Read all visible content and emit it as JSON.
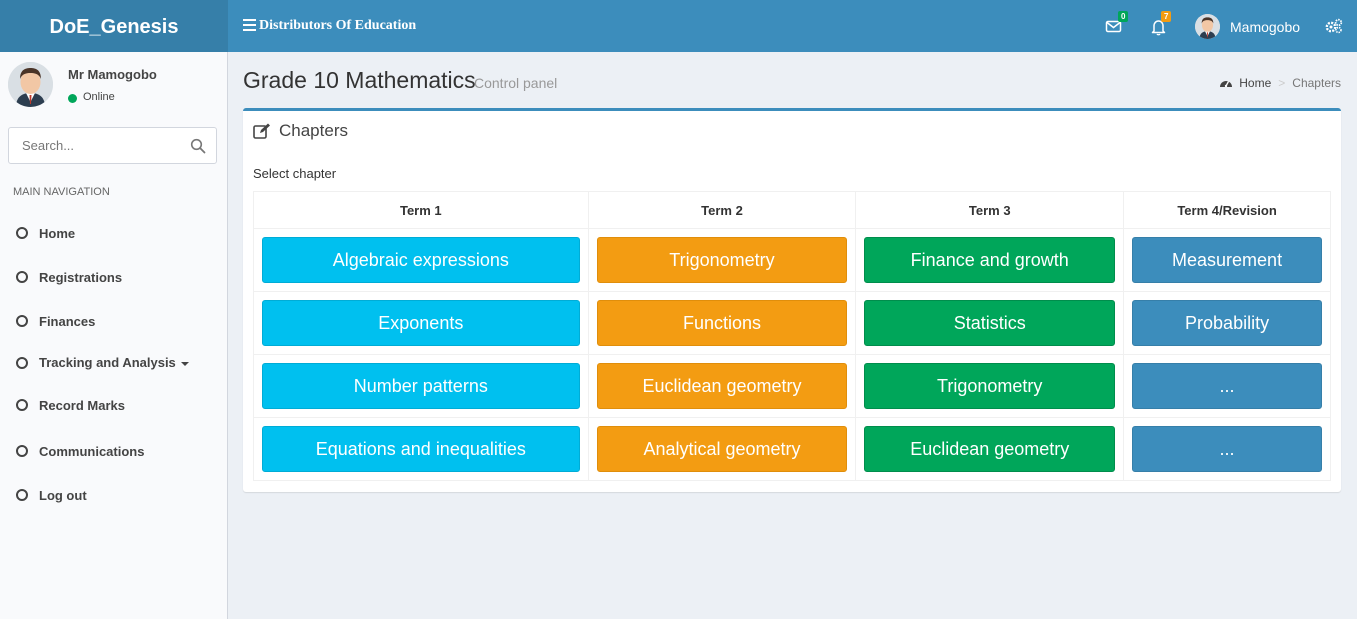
{
  "header": {
    "brand": "DoE_Genesis",
    "org_name": "Distributors Of Education",
    "mail_count": "0",
    "notif_count": "7",
    "user_name": "Mamogobo"
  },
  "sidebar": {
    "user_full_name": "Mr Mamogobo",
    "status": "Online",
    "search_placeholder": "Search...",
    "nav_header": "MAIN NAVIGATION",
    "items": [
      {
        "label": "Home"
      },
      {
        "label": "Registrations"
      },
      {
        "label": "Finances"
      },
      {
        "label": "Tracking and Analysis"
      },
      {
        "label": "Record Marks"
      },
      {
        "label": "Communications"
      },
      {
        "label": "Log out"
      }
    ]
  },
  "content": {
    "title": "Grade 10 Mathematics",
    "subtitle": "Control panel",
    "breadcrumb_home": "Home",
    "breadcrumb_active": "Chapters",
    "box_title": "Chapters",
    "select_label": "Select chapter",
    "terms": [
      "Term 1",
      "Term 2",
      "Term 3",
      "Term 4/Revision"
    ],
    "rows": [
      [
        "Algebraic expressions",
        "Trigonometry",
        "Finance and growth",
        "Measurement"
      ],
      [
        "Exponents",
        "Functions",
        "Statistics",
        "Probability"
      ],
      [
        "Number patterns",
        "Euclidean geometry",
        "Trigonometry",
        "..."
      ],
      [
        "Equations and inequalities",
        "Analytical geometry",
        "Euclidean geometry",
        "..."
      ]
    ]
  },
  "colors": {
    "header": "#3c8dbc",
    "logo_bg": "#367fa9",
    "term1": "#00c0ef",
    "term2": "#f39c12",
    "term3": "#00a65a",
    "term4": "#3c8dbc"
  }
}
